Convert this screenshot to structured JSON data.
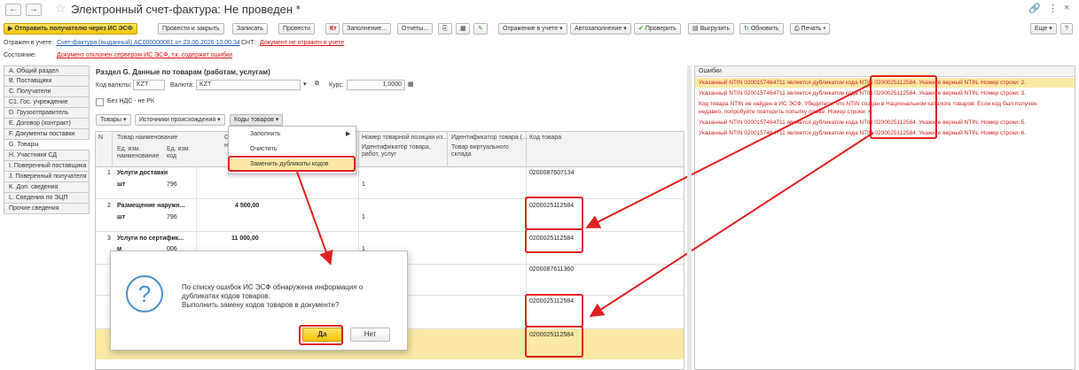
{
  "window": {
    "title": "Электронный счет-фактура:  Не проведен *",
    "back": "←",
    "forward": "→",
    "star": "☆",
    "link_icon": "🔗",
    "more_icon": "⋮",
    "close_icon": "×"
  },
  "toolbar": {
    "send": "Отправить получателю через ИС ЭСФ",
    "post_close": "Провести и закрыть",
    "save": "Записать",
    "post": "Провести",
    "fill": "Заполнение...",
    "reports": "Отчеты...",
    "reflect": "Отражение в учете",
    "autofill": "Автозаполнение",
    "check": "Проверить",
    "upload": "Выгрузить",
    "refresh": "Обновить",
    "print": "Печать",
    "more": "Еще",
    "help": "?"
  },
  "info": {
    "reflected_label": "Отражен в учете:",
    "reflected_link": "Счет-фактура (выданный) АС000000081 от 23.06.2026 10:00:34",
    "snt_label": "СНТ:",
    "snt_link": "Документ не отражен в учете",
    "state_label": "Состояние:",
    "state_link": "Документ отклонен сервером ИС ЭСФ, т.к. содержит ошибки"
  },
  "tabs": [
    "A. Общий раздел",
    "B. Поставщики",
    "C. Получатели",
    "C1. Гос. учреждение",
    "D. Грузоотправитель",
    "E. Договор (контракт)",
    "F. Документы поставки",
    "G. Товары",
    "H. Участники СД",
    "I. Поверенный поставщика",
    "J. Поверенный получателя",
    "K. Доп. сведения",
    "L. Сведения по ЭЦП",
    "Прочие сведения"
  ],
  "section": {
    "title": "Раздел G. Данные по товарам (работам, услугам)",
    "currency_code_label": "Код валюты:",
    "currency_code": "KZT",
    "currency_label": "Валюта:",
    "currency": "KZT",
    "rate_label": "Курс:",
    "rate": "1,0000",
    "no_vat": "Без НДС - не РК",
    "btn_goods": "Товары",
    "btn_sources": "Источники происхождения",
    "btn_codes": "Коды товаров"
  },
  "menu": {
    "fill": "Заполнить",
    "clear": "Очистить",
    "replace": "Заменить дубликаты кодов"
  },
  "grid": {
    "col_n": "N",
    "col_name": "Товар наименование",
    "col_unit_name": "Ед. изм. наименование",
    "col_unit_code": "Ед. изм. код",
    "col_s": "С",
    "col_s2": "н",
    "col_pos": "Номер товарной позиции из...",
    "col_pos_sub": "Идентификатор товара, работ, услуг",
    "col_id": "Идентификатор товара (...",
    "col_id_sub": "Товар виртуального склада",
    "col_code": "Код товара",
    "rows": [
      {
        "n": "1",
        "name": "Услуги доставки",
        "unit": "шт",
        "unit_code": "796",
        "sum": "",
        "pos": "1",
        "code": "0200087607134"
      },
      {
        "n": "2",
        "name": "Размещение наружн...",
        "unit": "шт",
        "unit_code": "796",
        "sum": "4 500,00",
        "pos": "1",
        "code": "0200025112584"
      },
      {
        "n": "3",
        "name": "Услуги по сертифик...",
        "unit": "м",
        "unit_code": "006",
        "sum": "11 000,00",
        "pos": "1",
        "code": "0200025112584"
      },
      {
        "n": "4",
        "name": "",
        "unit": "",
        "unit_code": "",
        "sum": "",
        "pos": "",
        "code": "0200087611360"
      },
      {
        "n": "5",
        "name": "",
        "unit": "",
        "unit_code": "",
        "sum": "",
        "pos": "",
        "code": "0200025112584"
      },
      {
        "n": "6",
        "name": "",
        "unit": "",
        "unit_code": "",
        "sum": "",
        "pos": "",
        "code": "0200025112584"
      }
    ]
  },
  "dialog": {
    "line1": "По списку ошибок ИС ЭСФ обнаружена информация о",
    "line2": "дубликатах кодов товаров.",
    "line3": "Выполнить замену кодов товаров в документе?",
    "yes": "Да",
    "no": "Нет",
    "icon": "?"
  },
  "errors": {
    "title": "Ошибки",
    "lines": [
      "Указанный NTIN 0200157464711 является дубликатом кода NTIN 0200025112584. Укажите верный NTIN. Номер строки: 2.",
      "Указанный NTIN 0200157464711 является дубликатом кода NTIN 0200025112584. Укажите верный NTIN. Номер строки: 3.",
      "Код товара NTIN не найден в ИС ЭСФ. Убедитесь, что NTIN создан в Национальном каталоге товаров. Если код был получен",
      "недавно, попробуйте повторить попытку позже. Номер строки: 4.",
      "Указанный NTIN 0200157464711 является дубликатом кода NTIN 0200025112584. Укажите верный NTIN. Номер строки: 5.",
      "Указанный NTIN 0200157464711 является дубликатом кода NTIN 0200025112584. Укажите верный NTIN. Номер строки: 6."
    ]
  },
  "colors": {
    "accent_yellow": "#f5c400",
    "error_red": "#d21f1f",
    "highlight_red": "#e02020",
    "selection": "#fbe9a5"
  }
}
